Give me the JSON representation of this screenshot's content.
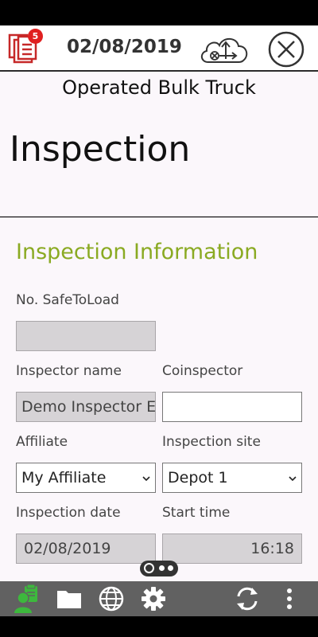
{
  "header": {
    "documents_badge": "5",
    "date": "02/08/2019"
  },
  "page": {
    "subtitle": "Operated Bulk Truck",
    "title": "Inspection"
  },
  "section": {
    "title": "Inspection Information",
    "fields": {
      "safetoload": {
        "label": "No. SafeToLoad",
        "value": ""
      },
      "inspector_name": {
        "label": "Inspector name",
        "value": "Demo Inspector E"
      },
      "coinspector": {
        "label": "Coinspector",
        "value": ""
      },
      "affiliate": {
        "label": "Affiliate",
        "value": "My Affiliate"
      },
      "inspection_site": {
        "label": "Inspection site",
        "value": "Depot 1"
      },
      "inspection_date": {
        "label": "Inspection date",
        "value": "02/08/2019"
      },
      "start_time": {
        "label": "Start time",
        "value": "16:18"
      }
    }
  },
  "colors": {
    "accent_green": "#8aaa22",
    "badge_red": "#e02020",
    "toolbar_gray": "#616161",
    "active_icon_green": "#3db83d"
  },
  "icons": {
    "documents": "documents-icon",
    "cloud_sync": "cloud-sync-icon",
    "close": "close-icon",
    "inspector": "inspector-icon",
    "folder": "folder-icon",
    "globe": "globe-icon",
    "settings": "gear-icon",
    "refresh": "refresh-icon",
    "more": "more-vertical-icon"
  }
}
